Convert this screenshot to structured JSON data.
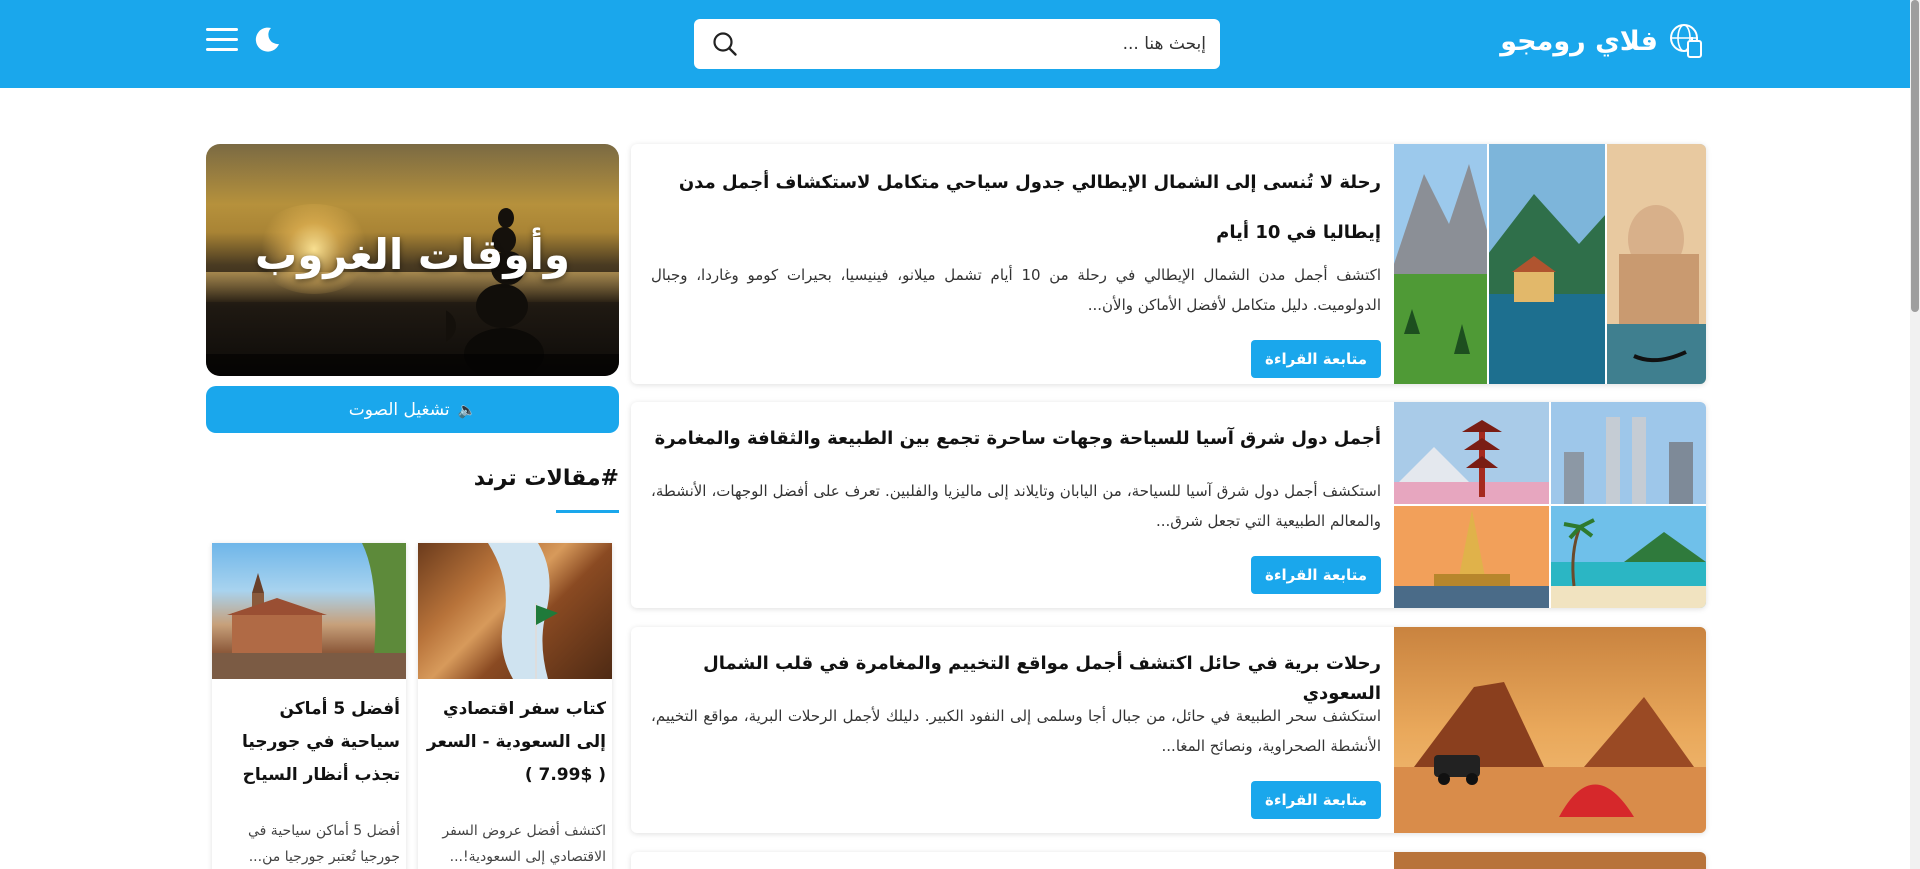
{
  "theme": {
    "accent": "#1aa7ec"
  },
  "header": {
    "logo_text": "فلاي رومجو",
    "search_placeholder": "إبحث هنا ..."
  },
  "sidebar": {
    "hero_title": "وأوقات الغروب",
    "audio_button_label": "تشغيل الصوت",
    "audio_icon": "🔈",
    "trending_heading": "#مقالات ترند",
    "trending": [
      {
        "title": "كتاب سفر اقتصادي إلى السعودية - السعر ( $7.99 )",
        "desc": "اكتشف أفضل عروض السفر الاقتصادي إلى السعودية!..."
      },
      {
        "title": "أفضل 5 أماكن سياحية في جورجيا تجذب أنظار السياح",
        "desc": "أفضل 5 أماكن سياحية في جورجيا تُعتبر جورجيا من..."
      }
    ]
  },
  "articles": [
    {
      "title": "رحلة لا تُنسى إلى الشمال الإيطالي جدول سياحي متكامل لاستكشاف أجمل مدن إيطاليا في 10 أيام",
      "desc": "اكتشف أجمل مدن الشمال الإيطالي في رحلة من 10 أيام تشمل ميلانو، فينيسيا، بحيرات كومو وغاردا، وجبال الدولوميت. دليل متكامل لأفضل الأماكن والأن...",
      "button": "متابعة القراءة"
    },
    {
      "title": "أجمل دول شرق آسيا للسياحة وجهات ساحرة تجمع بين الطبيعة والثقافة والمغامرة",
      "desc": "استكشف أجمل دول شرق آسيا للسياحة، من اليابان وتايلاند إلى ماليزيا والفلبين. تعرف على أفضل الوجهات، الأنشطة، والمعالم الطبيعية التي تجعل شرق...",
      "button": "متابعة القراءة"
    },
    {
      "title": "رحلات برية في حائل اكتشف أجمل مواقع التخييم والمغامرة في قلب الشمال السعودي",
      "desc": "استكشف سحر الطبيعة في حائل، من جبال أجا وسلمى إلى النفود الكبير. دليلك لأجمل الرحلات البرية، مواقع التخييم، الأنشطة الصحراوية، ونصائح المغا...",
      "button": "متابعة القراءة"
    }
  ]
}
